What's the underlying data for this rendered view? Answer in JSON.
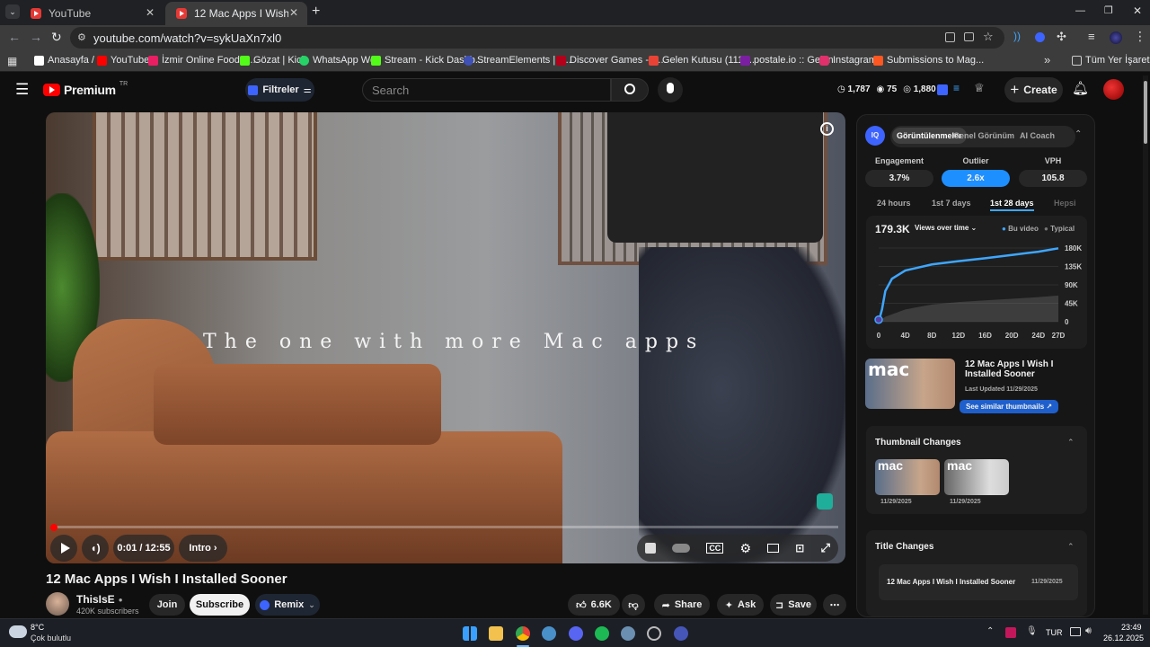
{
  "browser": {
    "tabs": [
      {
        "label": "YouTube",
        "active": false
      },
      {
        "label": "12 Mac Apps I Wish I Installed ",
        "active": true
      }
    ],
    "new_tab": "+",
    "url": "youtube.com/watch?v=sykUaXn7xl0",
    "window_controls": {
      "minimize": "—",
      "maximize": "❐",
      "close": "✕"
    },
    "bookmarks": [
      {
        "label": "Anasayfa / X",
        "color": "#ffffff"
      },
      {
        "label": "YouTube",
        "color": "#ff0000"
      },
      {
        "label": "İzmir Online Food O...",
        "color": "#e91e63"
      },
      {
        "label": "Gözat | Kick",
        "color": "#53fc18"
      },
      {
        "label": "WhatsApp Web",
        "color": "#25d366"
      },
      {
        "label": "Stream - Kick Dashb...",
        "color": "#53fc18"
      },
      {
        "label": "StreamElements | T...",
        "color": "#3f51b5"
      },
      {
        "label": "Discover Games - K...",
        "color": "#b3001b"
      },
      {
        "label": "Gelen Kutusu (111)...",
        "color": "#ea4335"
      },
      {
        "label": "postale.io :: Gelen",
        "color": "#7b1fa2"
      },
      {
        "label": "Instagram",
        "color": "#e1306c"
      },
      {
        "label": "Submissions to Mag...",
        "color": "#ff5722"
      }
    ],
    "bookmarks_overflow": "»",
    "all_bookmarks": "Tüm Yer İşaretleri"
  },
  "masthead": {
    "logo": "Premium",
    "region": "TR",
    "filters_label": "Filtreler",
    "search_placeholder": "Search",
    "stats": {
      "hours": "1,787",
      "checks": "75",
      "views": "1,880"
    },
    "create_label": "Create"
  },
  "player": {
    "overlay_text": "The one with more Mac apps",
    "time": "0:01 / 12:55",
    "chapter": "Intro",
    "progress_fraction": 0.001
  },
  "video": {
    "title": "12 Mac Apps I Wish I Installed Sooner",
    "channel": "ThisIsE",
    "subscribers": "420K subscribers",
    "join_label": "Join",
    "subscribe_label": "Subscribe",
    "remix_label": "Remix",
    "likes": "6.6K",
    "share_label": "Share",
    "ask_label": "Ask",
    "save_label": "Save"
  },
  "panel": {
    "tabs": [
      "Görüntülenmeler",
      "Genel Görünüm",
      "AI Coach"
    ],
    "metrics": [
      {
        "label": "Engagement",
        "value": "3.7%"
      },
      {
        "label": "Outlier",
        "value": "2.6x"
      },
      {
        "label": "VPH",
        "value": "105.8"
      }
    ],
    "ranges": [
      "24 hours",
      "1st 7 days",
      "1st 28 days",
      "Hepsi"
    ],
    "active_range": "1st 28 days",
    "views_total": "179.3K",
    "views_mode": "Views over time",
    "legend_this": "Bu video",
    "legend_typical": "Typical",
    "thumb_title": "12 Mac Apps I Wish I Installed Sooner",
    "last_updated": "Last Updated 11/29/2025",
    "similar_thumbs": "See similar thumbnails",
    "thumbnail_changes_title": "Thumbnail Changes",
    "thumbnail_changes": [
      {
        "date": "11/29/2025"
      },
      {
        "date": "11/29/2025"
      }
    ],
    "title_changes_title": "Title Changes",
    "title_change_entry": "12 Mac Apps I Wish I Installed Sooner",
    "title_change_date": "11/29/2025"
  },
  "chart_data": {
    "type": "area",
    "x_ticks": [
      "0",
      "4D",
      "8D",
      "12D",
      "16D",
      "20D",
      "24D",
      "27D"
    ],
    "y_ticks": [
      "180K",
      "135K",
      "90K",
      "45K",
      "0"
    ],
    "ylim": [
      0,
      180000
    ],
    "series": [
      {
        "name": "Bu video",
        "x": [
          0,
          0.5,
          1,
          2,
          4,
          8,
          12,
          16,
          20,
          24,
          27
        ],
        "values": [
          0,
          30000,
          75000,
          105000,
          125000,
          140000,
          148000,
          155000,
          163000,
          171000,
          179300
        ],
        "color": "#3ea6ff"
      },
      {
        "name": "Typical",
        "x": [
          0,
          1,
          4,
          8,
          12,
          16,
          20,
          24,
          27
        ],
        "values": [
          0,
          12000,
          30000,
          42000,
          48000,
          52000,
          56000,
          60000,
          64000
        ],
        "color": "#777777"
      }
    ]
  },
  "taskbar": {
    "weather_temp": "8°C",
    "weather_desc": "Çok bulutlu",
    "lang": "TUR",
    "time": "23:49",
    "date": "26.12.2025"
  }
}
